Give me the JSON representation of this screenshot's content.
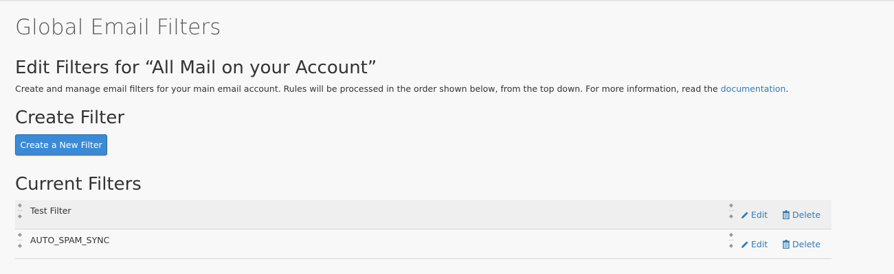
{
  "page": {
    "title": "Global Email Filters"
  },
  "edit_section": {
    "heading": "Edit Filters for “All Mail on your Account”",
    "description_text": "Create and manage email filters for your main email account. Rules will be processed in the order shown below, from the top down. For more information, read the ",
    "documentation_link": "documentation",
    "description_end": "."
  },
  "create_section": {
    "heading": "Create Filter",
    "button_label": "Create a New Filter"
  },
  "current_section": {
    "heading": "Current Filters",
    "filters": [
      {
        "name": "Test Filter",
        "edit_label": "Edit",
        "delete_label": "Delete"
      },
      {
        "name": "AUTO_SPAM_SYNC",
        "edit_label": "Edit",
        "delete_label": "Delete"
      }
    ]
  },
  "icons": {
    "drag_handle": "drag-handle-icon",
    "edit": "pencil-icon",
    "delete": "trash-icon"
  },
  "colors": {
    "primary_button": "#3a8ad6",
    "link": "#337ab7",
    "background": "#f8f8f8",
    "row_alt": "#efefef"
  }
}
